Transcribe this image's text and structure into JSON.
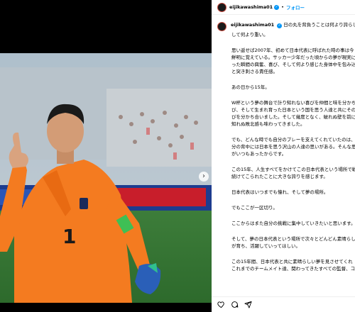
{
  "header": {
    "username": "eijikawashima01",
    "separator": "•",
    "follow_label": "フォロー"
  },
  "caption": {
    "username": "eijikawashima01",
    "line1": "日の丸を背負うことは何より誇らしく、",
    "line1_cont": "して何より重い。",
    "paragraphs": [
      "思い返せば2007年、初めて日本代表に呼ばれた時の事は今",
      "鮮明に覚えている。サッカー少年だった頃からの夢が現実に",
      "った瞬間の興奮、喜び、そして何より感じた身体中を包み込",
      "と突き刺さる責任感。",
      "あの日から15年。",
      "W杯という夢の舞台で計り知れない喜びを仲間と味を分かち合",
      "び、そして生まれ育った日本という国を思う人達と共にその",
      "びを分かち合いました。そして幾度となく、破れぬ壁を前に",
      "知れぬ敗北感も味わってきました。",
      "でも、どんな時でも自分のプレーを支えてくれていたのは、",
      "分の背中には日本を思う沢山の人達の思いがある。そんな思",
      "がいつもあったからです。",
      "この15年、人生すべてをかけてこの日本代表という場所で戦",
      "続けてこられたことに大きな誇りを感じます。",
      "日本代表はいつまでも憧れ、そして夢の場所。",
      "でもここが一区切り。",
      "ここからはまた自分の挑戦に集中していきたいと思います。",
      "そして、夢の日本代表という場所で次々とどんどん素晴らしい",
      "が育ち、活躍していってほしい。",
      "この15年間、日本代表と共に素晴らしい夢を見させてくれ",
      "これまでのチームメイト達、関わってきたすべての監督、コ"
    ]
  },
  "actions": {
    "icons": [
      "heart-icon",
      "comment-icon",
      "share-icon"
    ]
  },
  "colors": {
    "accent": "#0095f6",
    "jersey": "#f47b20",
    "text": "#000000"
  }
}
